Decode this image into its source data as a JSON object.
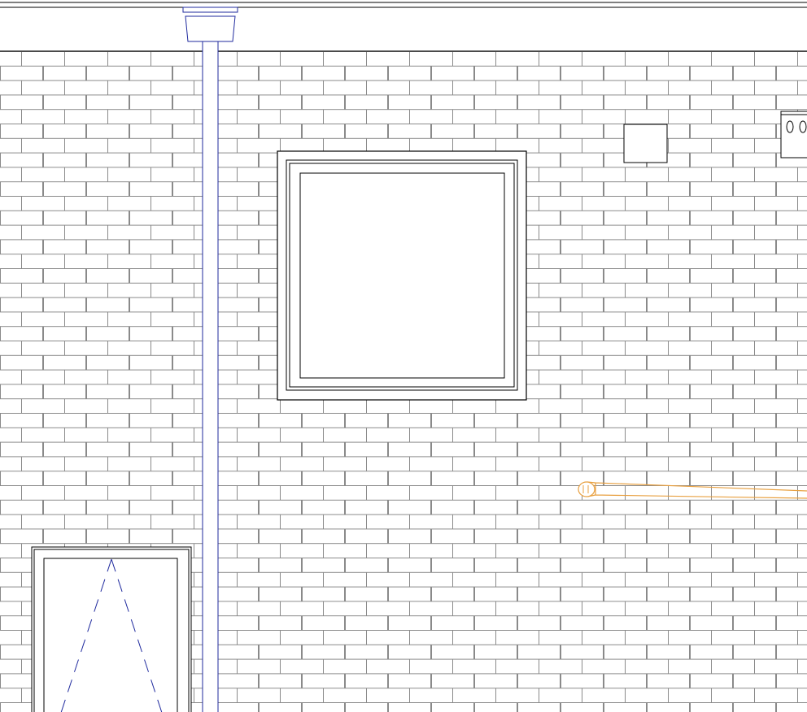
{
  "drawing": {
    "kind": "CAD wall elevation",
    "elements": [
      "roof-fascia",
      "brick-wall",
      "downspout",
      "rainwater-head",
      "window",
      "small-panel",
      "outlet-box",
      "hose-bib-pipe",
      "door"
    ],
    "colors": {
      "background": "#ffffff",
      "brick_lines": "#7f7f7f",
      "linework": "#000000",
      "downspout": "#1f2a9e",
      "door_swing": "#1f2a9e",
      "pipe": "#e8a040"
    },
    "brick_pattern": "running bond"
  }
}
